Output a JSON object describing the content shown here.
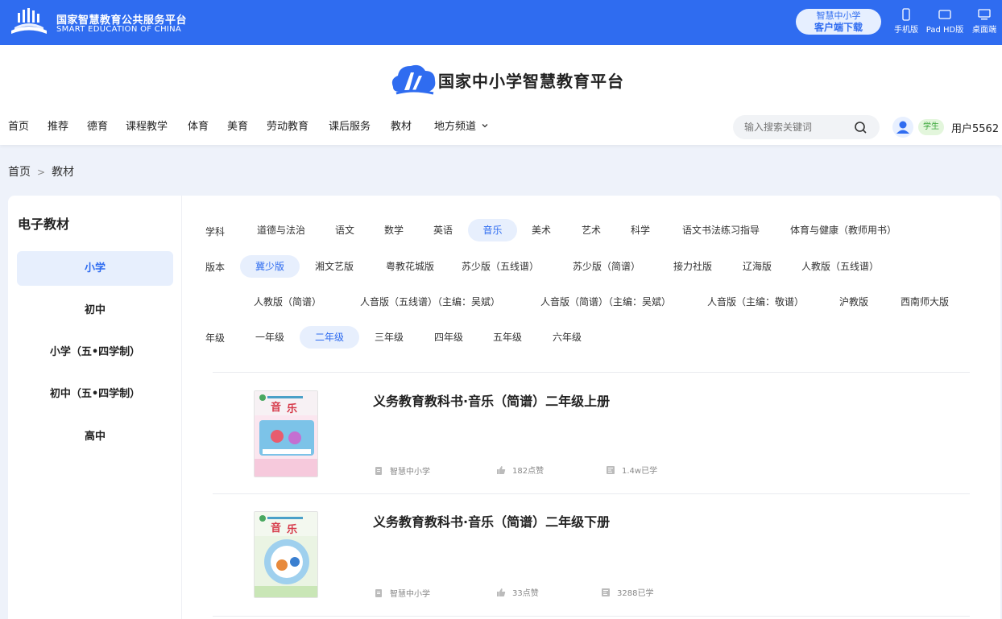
{
  "topbar": {
    "title": "国家智慧教育公共服务平台",
    "subtitle": "SMART EDUCATION OF CHINA",
    "download_line1": "智慧中小学",
    "download_line2": "客户端下载",
    "devices": [
      {
        "label": "手机版",
        "icon": "phone-icon"
      },
      {
        "label": "Pad HD版",
        "icon": "tablet-icon"
      },
      {
        "label": "桌面端",
        "icon": "desktop-icon"
      }
    ]
  },
  "brand": {
    "name": "国家中小学智慧教育平台"
  },
  "nav": {
    "items": [
      "首页",
      "推荐",
      "德育",
      "课程教学",
      "体育",
      "美育",
      "劳动教育",
      "课后服务",
      "教材",
      "地方频道"
    ]
  },
  "search": {
    "placeholder": "输入搜索关键词"
  },
  "user": {
    "badge": "学生",
    "name": "用户5562"
  },
  "breadcrumb": {
    "home": "首页",
    "sep": ">",
    "current": "教材"
  },
  "sidebar": {
    "title": "电子教材",
    "items": [
      "小学",
      "初中",
      "小学（五•四学制）",
      "初中（五•四学制）",
      "高中"
    ],
    "active_index": 0
  },
  "filters": {
    "subject_label": "学科",
    "subjects": [
      "道德与法治",
      "语文",
      "数学",
      "英语",
      "音乐",
      "美术",
      "艺术",
      "科学",
      "语文书法练习指导",
      "体育与健康（教师用书）"
    ],
    "edition_label": "版本",
    "editions": [
      "冀少版",
      "湘文艺版",
      "粤教花城版",
      "苏少版（五线谱）",
      "苏少版（简谱）",
      "接力社版",
      "辽海版",
      "人教版（五线谱）",
      "人教版（简谱）",
      "人音版（五线谱）（主编：吴斌）",
      "人音版（简谱）（主编：吴斌）",
      "人音版（主编：敬谱）",
      "沪教版",
      "西南师大版"
    ],
    "grade_label": "年级",
    "grades": [
      "一年级",
      "二年级",
      "三年级",
      "四年级",
      "五年级",
      "六年级"
    ]
  },
  "books": [
    {
      "title": "义务教育教科书·音乐（简谱）二年级上册",
      "source": "智慧中小学",
      "likes": "182点赞",
      "learners": "1.4w已学"
    },
    {
      "title": "义务教育教科书·音乐（简谱）二年级下册",
      "source": "智慧中小学",
      "likes": "33点赞",
      "learners": "3288已学"
    }
  ],
  "colors": {
    "primary": "#2f6cf0",
    "active_bg": "#e7effd",
    "badge_bg": "#e3f6dc",
    "badge_text": "#3aa63a"
  }
}
